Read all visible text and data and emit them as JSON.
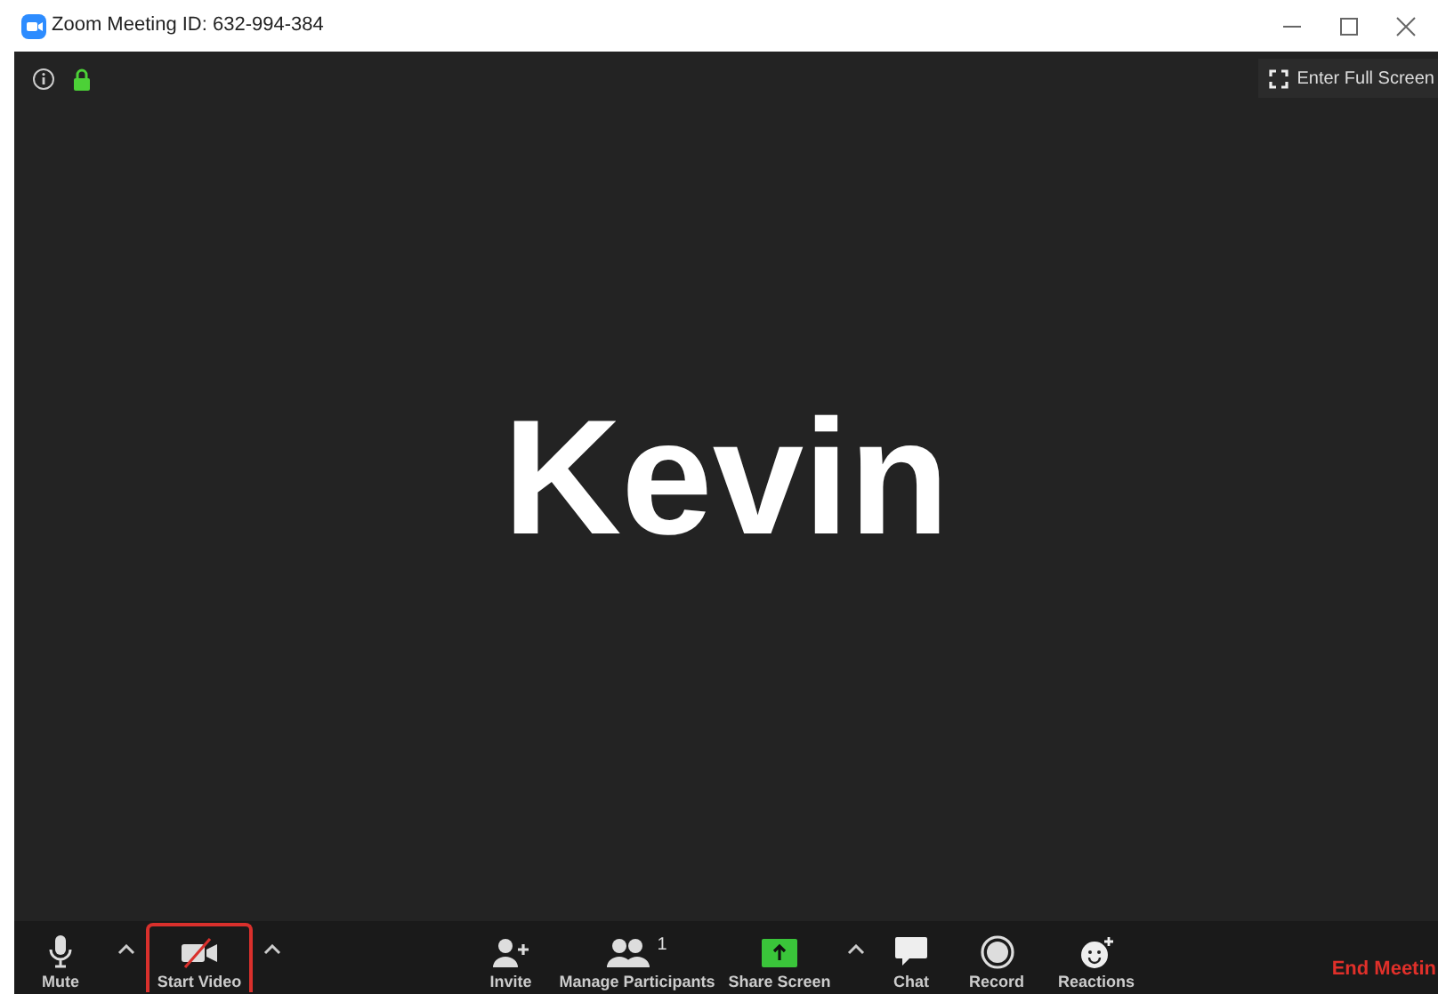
{
  "window": {
    "title": "Zoom Meeting ID: 632-994-384"
  },
  "top_bar": {
    "fullscreen_button": "Enter Full Screen"
  },
  "video": {
    "name": "Kevin"
  },
  "toolbar": {
    "left": [
      {
        "kind": "mic",
        "label": "Mute",
        "highlighted": false
      },
      {
        "kind": "caret"
      },
      {
        "kind": "video-off",
        "label": "Start Video",
        "highlighted": true
      },
      {
        "kind": "caret"
      }
    ],
    "center": [
      {
        "kind": "invite",
        "label": "Invite",
        "highlighted": false
      },
      {
        "kind": "participants",
        "label": "Manage Participants",
        "count": "1",
        "highlighted": false
      },
      {
        "kind": "share",
        "label": "Share Screen",
        "highlighted": false
      },
      {
        "kind": "caret"
      },
      {
        "kind": "chat",
        "label": "Chat",
        "highlighted": false
      },
      {
        "kind": "record",
        "label": "Record",
        "highlighted": false
      },
      {
        "kind": "reactions",
        "label": "Reactions",
        "highlighted": false
      }
    ],
    "end_button": "End Meetin"
  }
}
